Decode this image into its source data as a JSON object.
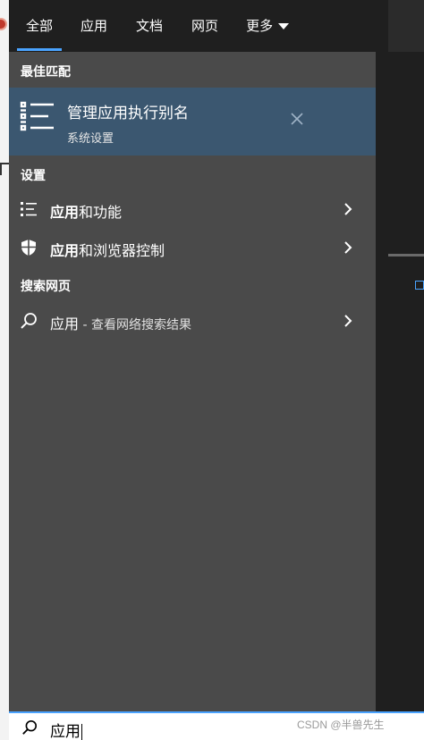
{
  "tabs": [
    {
      "label": "全部",
      "active": true
    },
    {
      "label": "应用",
      "active": false
    },
    {
      "label": "文档",
      "active": false
    },
    {
      "label": "网页",
      "active": false
    },
    {
      "label": "更多",
      "active": false
    }
  ],
  "best_match": {
    "section": "最佳匹配",
    "title": "管理应用执行别名",
    "subtitle": "系统设置",
    "icon": "list-settings-icon"
  },
  "settings": {
    "section": "设置",
    "items": [
      {
        "bold": "应用",
        "rest": "和功能",
        "icon": "list-icon"
      },
      {
        "bold": "应用",
        "rest": "和浏览器控制",
        "icon": "shield-icon"
      }
    ]
  },
  "web": {
    "section": "搜索网页",
    "query": "应用",
    "suffix": " - 查看网络搜索结果",
    "icon": "search-icon"
  },
  "search": {
    "value": "应用"
  },
  "watermark": "CSDN @半兽先生",
  "colors": {
    "accent": "#4aa3ff",
    "selected_bg": "#3b5770",
    "panel_bg": "#4a4a4a",
    "tabbar_bg": "#1f1f1f"
  }
}
